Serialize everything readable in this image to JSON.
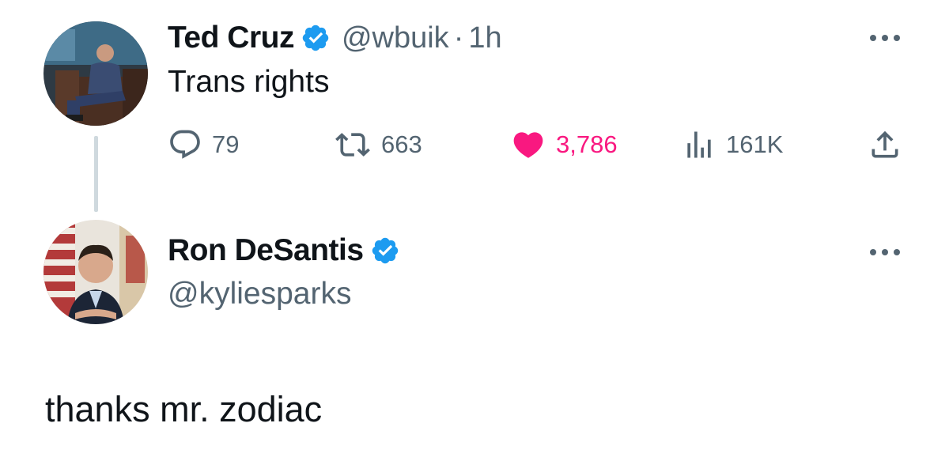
{
  "colors": {
    "text_primary": "#0f1419",
    "text_secondary": "#536471",
    "verified_blue": "#1d9bf0",
    "like_pink": "#f91880",
    "thread_line": "#cfd9de"
  },
  "tweet": {
    "display_name": "Ted Cruz",
    "verified": true,
    "handle": "@wbuik",
    "separator": "·",
    "time": "1h",
    "text": "Trans rights",
    "more_icon": "ellipsis-icon",
    "avatar_icon": "avatar-photo",
    "actions": {
      "reply": {
        "icon": "reply-icon",
        "count": "79"
      },
      "retweet": {
        "icon": "retweet-icon",
        "count": "663"
      },
      "like": {
        "icon": "heart-filled-icon",
        "count": "3,786",
        "liked": true
      },
      "views": {
        "icon": "views-chart-icon",
        "count": "161K"
      },
      "share": {
        "icon": "share-icon"
      }
    }
  },
  "reply": {
    "display_name": "Ron DeSantis",
    "verified": true,
    "handle": "@kyliesparks",
    "text": "thanks mr. zodiac",
    "more_icon": "ellipsis-icon",
    "avatar_icon": "avatar-photo"
  }
}
